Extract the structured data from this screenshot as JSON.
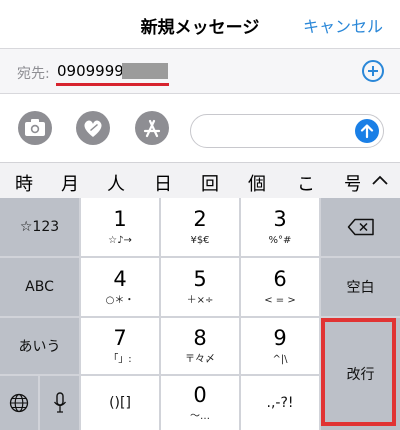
{
  "nav": {
    "title": "新規メッセージ",
    "cancel_label": "キャンセル"
  },
  "recipient": {
    "label": "宛先:",
    "number": "0909999"
  },
  "predictions": [
    "時",
    "月",
    "人",
    "日",
    "回",
    "個",
    "こ",
    "号"
  ],
  "keys": {
    "symbols_label": "☆123",
    "abc_label": "ABC",
    "kana_label": "あいう",
    "space_label": "空白",
    "return_label": "改行",
    "k1_main": "1",
    "k1_sub": "☆♪→",
    "k2_main": "2",
    "k2_sub": "¥$€",
    "k3_main": "3",
    "k3_sub": "%°#",
    "k4_main": "4",
    "k4_sub": "○＊・",
    "k5_main": "5",
    "k5_sub": "＋×÷",
    "k6_main": "6",
    "k6_sub": "< = >",
    "k7_main": "7",
    "k7_sub": "「」:",
    "k8_main": "8",
    "k8_sub": "〒々〆",
    "k9_main": "9",
    "k9_sub": "^|\\",
    "k0_main": "0",
    "k0_sub": "〜…",
    "paren_label": "()[]",
    "punct_label": ".,-?!"
  },
  "colors": {
    "accent": "#2a87d8",
    "highlight": "#e13333",
    "keyboard_bg": "#d1d3d9"
  }
}
